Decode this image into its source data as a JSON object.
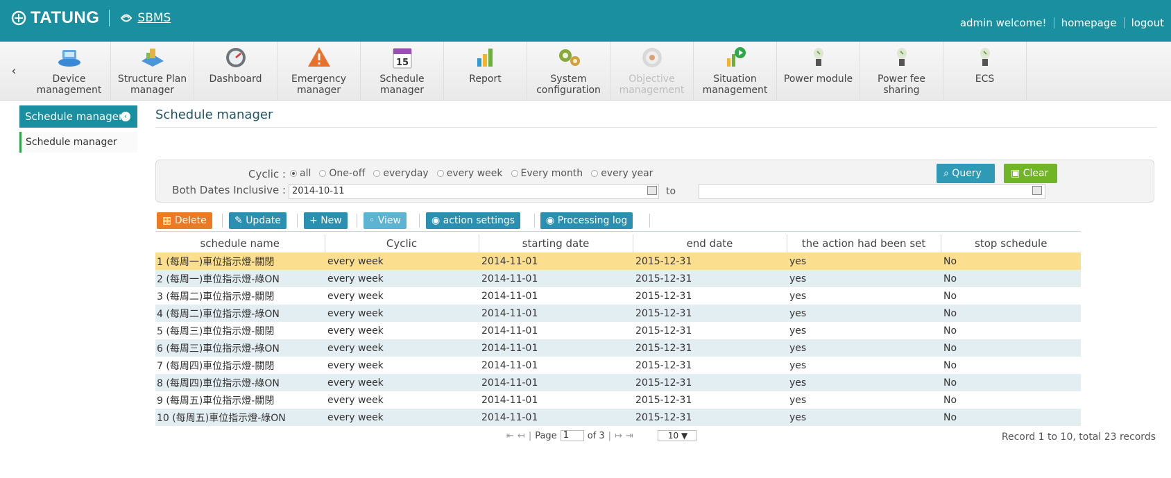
{
  "header": {
    "brand_tatung": "TATUNG",
    "brand_sbms": "SBMS",
    "links": [
      "admin welcome!",
      "homepage",
      "logout"
    ]
  },
  "nav": {
    "items": [
      {
        "label": "Device management",
        "icon": "network-devices-icon"
      },
      {
        "label": "Structure Plan manager",
        "icon": "building-plan-icon"
      },
      {
        "label": "Dashboard",
        "icon": "gauge-icon"
      },
      {
        "label": "Emergency manager",
        "icon": "warning-icon"
      },
      {
        "label": "Schedule manager",
        "icon": "calendar-icon"
      },
      {
        "label": "Report",
        "icon": "bar-chart-icon"
      },
      {
        "label": "System configuration",
        "icon": "gears-icon"
      },
      {
        "label": "Objective management",
        "icon": "target-icon"
      },
      {
        "label": "Situation management",
        "icon": "play-chart-icon"
      },
      {
        "label": "Power module",
        "icon": "bulb-plug-icon"
      },
      {
        "label": "Power fee sharing",
        "icon": "bulb-plug-icon"
      },
      {
        "label": "ECS",
        "icon": "bulb-plug-icon"
      }
    ]
  },
  "sidebar": {
    "title": "Schedule manager",
    "items": [
      "Schedule manager"
    ]
  },
  "main": {
    "title": "Schedule manager",
    "query_label": "Query",
    "clear_label": "Clear",
    "cyclic_label": "Cyclic :",
    "cyclic_options": [
      "all",
      "One-off",
      "everyday",
      "every week",
      "Every month",
      "every year"
    ],
    "cyclic_selected": "all",
    "dates_label": "Both Dates Inclusive :",
    "date_from": "2014-10-11",
    "to_label": "to",
    "date_to": ""
  },
  "toolbar": {
    "delete": "Delete",
    "update": "Update",
    "new": "New",
    "view": "View",
    "action_settings": "action settings",
    "processing_log": "Processing log"
  },
  "table": {
    "columns": [
      "schedule name",
      "Cyclic",
      "starting date",
      "end date",
      "the action had been set",
      "stop schedule"
    ],
    "rows": [
      [
        "1 (每周一)車位指示燈-關閉",
        "every week",
        "2014-11-01",
        "2015-12-31",
        "yes",
        "No"
      ],
      [
        "2 (每周一)車位指示燈-綠ON",
        "every week",
        "2014-11-01",
        "2015-12-31",
        "yes",
        "No"
      ],
      [
        "3 (每周二)車位指示燈-關閉",
        "every week",
        "2014-11-01",
        "2015-12-31",
        "yes",
        "No"
      ],
      [
        "4 (每周二)車位指示燈-綠ON",
        "every week",
        "2014-11-01",
        "2015-12-31",
        "yes",
        "No"
      ],
      [
        "5 (每周三)車位指示燈-關閉",
        "every week",
        "2014-11-01",
        "2015-12-31",
        "yes",
        "No"
      ],
      [
        "6 (每周三)車位指示燈-綠ON",
        "every week",
        "2014-11-01",
        "2015-12-31",
        "yes",
        "No"
      ],
      [
        "7 (每周四)車位指示燈-關閉",
        "every week",
        "2014-11-01",
        "2015-12-31",
        "yes",
        "No"
      ],
      [
        "8 (每周四)車位指示燈-綠ON",
        "every week",
        "2014-11-01",
        "2015-12-31",
        "yes",
        "No"
      ],
      [
        "9 (每周五)車位指示燈-關閉",
        "every week",
        "2014-11-01",
        "2015-12-31",
        "yes",
        "No"
      ],
      [
        "10 (每周五)車位指示燈-綠ON",
        "every week",
        "2014-11-01",
        "2015-12-31",
        "yes",
        "No"
      ]
    ]
  },
  "pager": {
    "page_label": "Page",
    "page": "1",
    "of_label": "of 3",
    "page_size": "10",
    "records": "Record 1 to 10, total 23 records"
  }
}
